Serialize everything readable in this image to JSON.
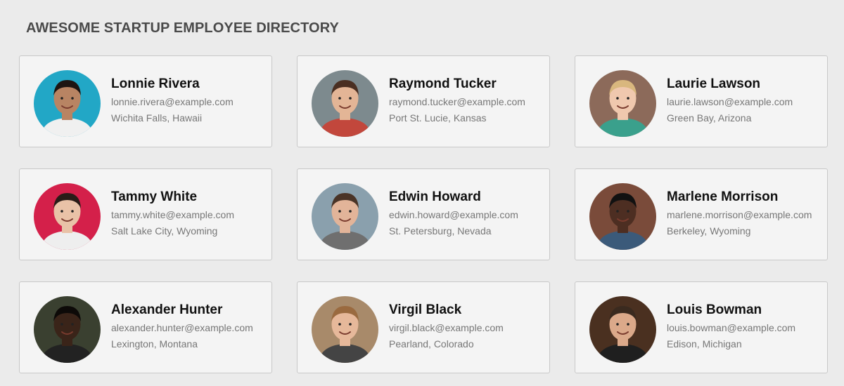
{
  "header": {
    "title": "AWESOME STARTUP EMPLOYEE DIRECTORY"
  },
  "employees": [
    {
      "name": "Lonnie Rivera",
      "email": "lonnie.rivera@example.com",
      "location": "Wichita Falls, Hawaii",
      "bg": "#22a7c6",
      "skin": "#b88463",
      "hair": "#1d1512",
      "shirt": "#f0f0f0"
    },
    {
      "name": "Raymond Tucker",
      "email": "raymond.tucker@example.com",
      "location": "Port St. Lucie, Kansas",
      "bg": "#7d8a8e",
      "skin": "#e3b596",
      "hair": "#4a2f22",
      "shirt": "#c2473c"
    },
    {
      "name": "Laurie Lawson",
      "email": "laurie.lawson@example.com",
      "location": "Green Bay, Arizona",
      "bg": "#8c6a5a",
      "skin": "#f0c8ae",
      "hair": "#d9b77e",
      "shirt": "#3aa08c"
    },
    {
      "name": "Tammy White",
      "email": "tammy.white@example.com",
      "location": "Salt Lake City, Wyoming",
      "bg": "#d4204a",
      "skin": "#e9c2a7",
      "hair": "#2a1c17",
      "shirt": "#eeeeee"
    },
    {
      "name": "Edwin Howard",
      "email": "edwin.howard@example.com",
      "location": "St. Petersburg, Nevada",
      "bg": "#8aa0ad",
      "skin": "#e2b499",
      "hair": "#4a3427",
      "shirt": "#6f6f6f"
    },
    {
      "name": "Marlene Morrison",
      "email": "marlene.morrison@example.com",
      "location": "Berkeley, Wyoming",
      "bg": "#7a4b3a",
      "skin": "#4d2e22",
      "hair": "#111111",
      "shirt": "#3b5a7a"
    },
    {
      "name": "Alexander Hunter",
      "email": "alexander.hunter@example.com",
      "location": "Lexington, Montana",
      "bg": "#3a4030",
      "skin": "#3a2419",
      "hair": "#0d0a08",
      "shirt": "#222222"
    },
    {
      "name": "Virgil Black",
      "email": "virgil.black@example.com",
      "location": "Pearland, Colorado",
      "bg": "#a88a6a",
      "skin": "#e6b89a",
      "hair": "#9a6a3f",
      "shirt": "#444444"
    },
    {
      "name": "Louis Bowman",
      "email": "louis.bowman@example.com",
      "location": "Edison, Michigan",
      "bg": "#4a3020",
      "skin": "#dba98a",
      "hair": "#3a2a1f",
      "shirt": "#1f1f1f"
    }
  ]
}
